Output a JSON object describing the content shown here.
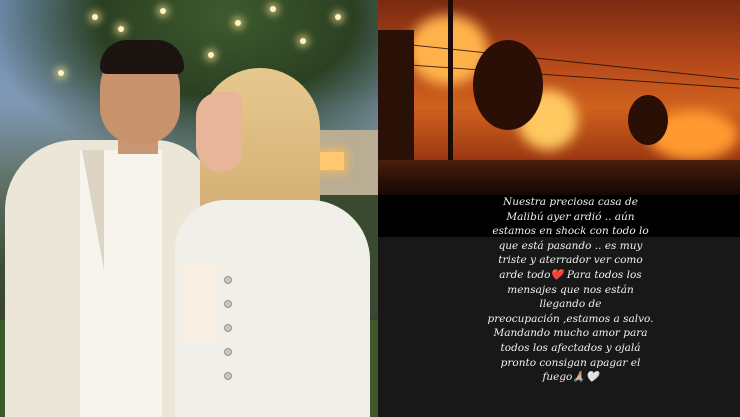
{
  "caption": {
    "lines": [
      "Nuestra preciosa casa de",
      "Malibú ayer ardió .. aún",
      "estamos en shock con todo lo",
      "que está pasando ..  es muy",
      "triste y aterrador ver como",
      "arde todo❤️ Para todos los",
      "mensajes que nos están",
      "llegando de",
      "preocupación ,estamos a salvo.",
      "Mandando mucho amor para",
      "todos los afectados y ojalá",
      "pronto consigan apagar el",
      "fuego🙏🏼🤍"
    ]
  },
  "colors": {
    "caption_text": "#f0f0f0",
    "fire": "#d0621e",
    "caption_background": "#181818"
  }
}
